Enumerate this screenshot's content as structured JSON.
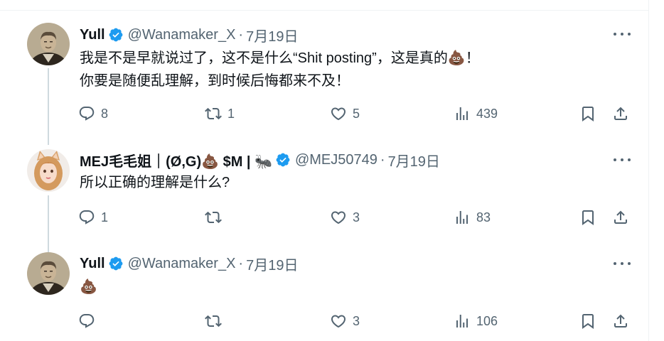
{
  "tweets": [
    {
      "name": "Yull",
      "handle": "@Wanamaker_X",
      "dot": "·",
      "date": "7月19日",
      "lines": [
        "我是不是早就说过了，这不是什么“Shit posting”，这是真的💩！",
        "你要是随便乱理解，到时候后悔都来不及！"
      ],
      "replies": "8",
      "retweets": "1",
      "likes": "5",
      "views": "439",
      "avatar_icon": "portrait-man-sepia"
    },
    {
      "name": "MEJ毛毛姐｜(Ø,G)💩 $M | 🐜",
      "handle": "@MEJ50749",
      "dot": "·",
      "date": "7月19日",
      "lines": [
        "所以正确的理解是什么?"
      ],
      "replies": "1",
      "retweets": "",
      "likes": "3",
      "views": "83",
      "avatar_icon": "portrait-woman-animal-ears"
    },
    {
      "name": "Yull",
      "handle": "@Wanamaker_X",
      "dot": "·",
      "date": "7月19日",
      "lines": [
        "💩"
      ],
      "replies": "",
      "retweets": "",
      "likes": "3",
      "views": "106",
      "avatar_icon": "portrait-man-sepia"
    }
  ],
  "colors": {
    "text": "#0f1419",
    "muted": "#536471",
    "verified_blue": "#1d9bf0",
    "thread_line": "#cfd9de"
  }
}
